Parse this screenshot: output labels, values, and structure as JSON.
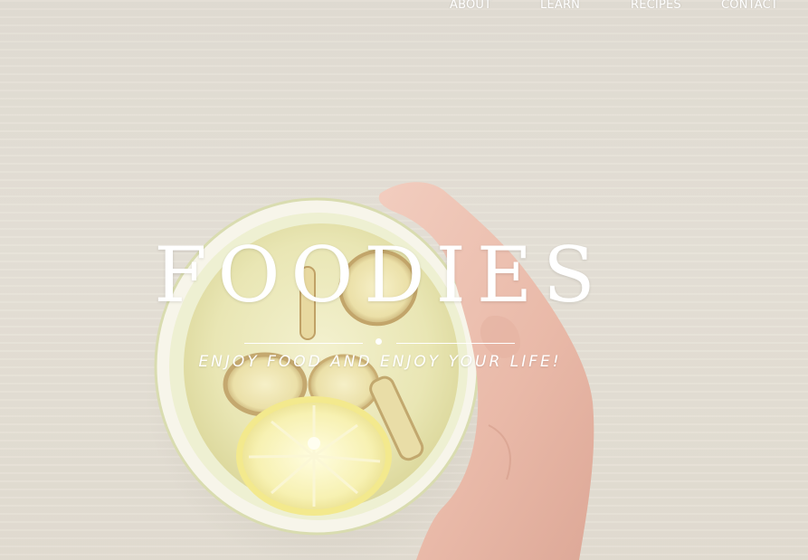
{
  "nav": {
    "items": [
      {
        "label": "ABOUT"
      },
      {
        "label": "LEARN"
      },
      {
        "label": "RECIPES"
      },
      {
        "label": "CONTACT"
      }
    ]
  },
  "hero": {
    "title": "FOODIES",
    "tagline": "ENJOY FOOD AND ENJOY YOUR LIFE!"
  },
  "colors": {
    "text": "#ffffff",
    "background": "#e4dfd5"
  }
}
